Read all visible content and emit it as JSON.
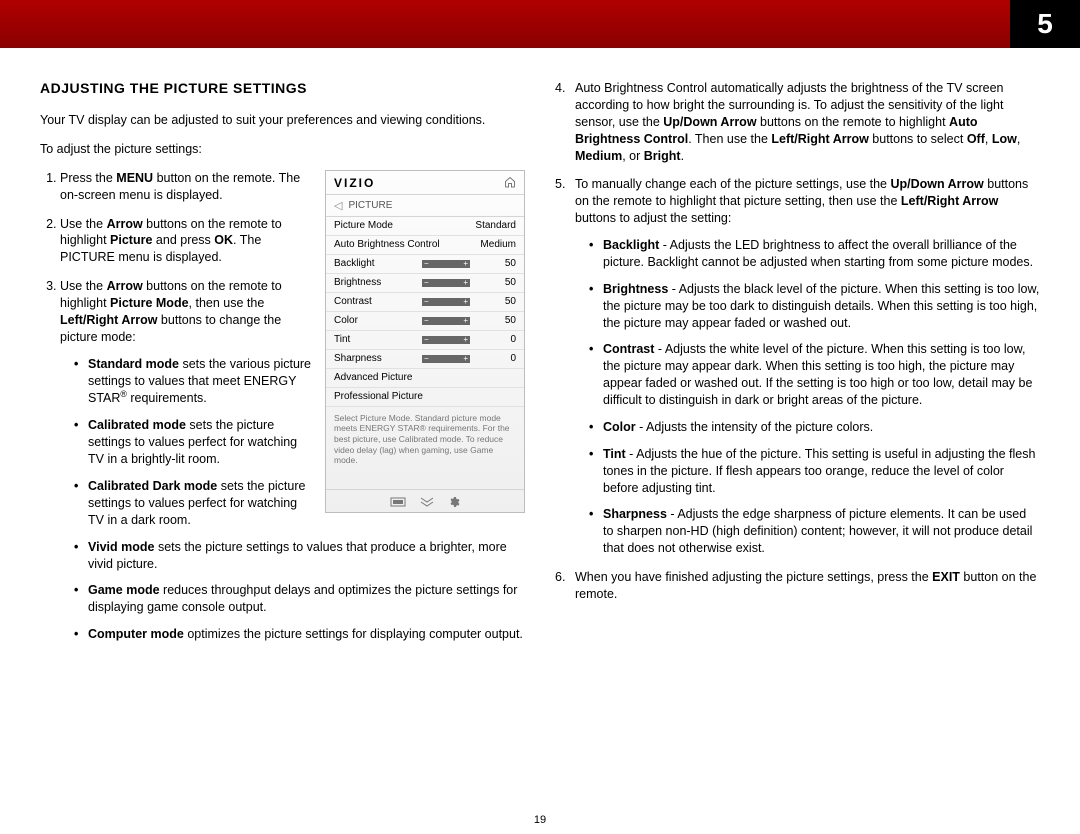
{
  "chapter_number": "5",
  "page_number": "19",
  "section_title": "ADJUSTING THE PICTURE SETTINGS",
  "intro1": "Your TV display can be adjusted to suit your preferences and viewing conditions.",
  "intro2": "To adjust the picture settings:",
  "step1_a": "Press the ",
  "step1_menu": "MENU",
  "step1_b": " button on the remote. The on-screen menu is displayed.",
  "step2_a": "Use the ",
  "step2_arrow": "Arrow",
  "step2_b": " buttons on the remote to highlight ",
  "step2_picture": "Picture",
  "step2_c": " and press ",
  "step2_ok": "OK",
  "step2_d": ". The PICTURE menu is displayed.",
  "step3_a": "Use the ",
  "step3_arrow": "Arrow",
  "step3_b": " buttons on the remote to highlight ",
  "step3_pm": "Picture Mode",
  "step3_c": ", then use the ",
  "step3_lr": "Left/Right Arrow",
  "step3_d": " buttons to change the picture mode:",
  "modes": {
    "standard_t": "Standard mode",
    "standard_d": " sets the various picture settings to values that meet ENERGY STAR",
    "standard_suffix": " requirements.",
    "calibrated_t": "Calibrated mode",
    "calibrated_d": " sets the picture settings to values perfect for watching TV in a brightly-lit room.",
    "calibrated_dark_t": "Calibrated Dark mode",
    "calibrated_dark_d": " sets the picture settings to values perfect for watching TV in a dark room.",
    "vivid_t": "Vivid mode",
    "vivid_d": " sets the picture settings to values that produce a brighter, more vivid picture.",
    "game_t": "Game mode",
    "game_d": " reduces throughput delays and optimizes the picture settings for displaying game console output.",
    "computer_t": "Computer mode",
    "computer_d": " optimizes the picture settings for displaying computer output."
  },
  "step4_a": "Auto Brightness Control automatically adjusts the brightness of the TV screen according to how bright the surrounding is. To adjust the sensitivity of the light sensor, use the ",
  "step4_ud": "Up/Down Arrow",
  "step4_b": " buttons on the remote to highlight ",
  "step4_abc": "Auto Brightness Control",
  "step4_c": ". Then use the ",
  "step4_lr": "Left/Right Arrow",
  "step4_d": " buttons to select ",
  "step4_off": "Off",
  "step4_sep1": ", ",
  "step4_low": "Low",
  "step4_sep2": ", ",
  "step4_med": "Medium",
  "step4_sep3": ", or ",
  "step4_bright": "Bright",
  "step4_e": ".",
  "step5_a": "To manually change each of the picture settings, use the ",
  "step5_ud": "Up/Down Arrow",
  "step5_b": " buttons on the remote to highlight that picture setting, then use the ",
  "step5_lr": "Left/Right Arrow",
  "step5_c": " buttons to adjust the setting:",
  "settings": {
    "backlight_t": "Backlight",
    "backlight_d": " - Adjusts the LED brightness to affect the overall brilliance of the picture. Backlight cannot be adjusted when starting from some picture modes.",
    "brightness_t": "Brightness",
    "brightness_d": " - Adjusts the black level of the picture. When this setting is too low, the picture may be too dark to distinguish details. When this setting is too high, the picture may appear faded or washed out.",
    "contrast_t": "Contrast",
    "contrast_d": " - Adjusts the white level of the picture. When this setting is too low, the picture may appear dark. When this setting is too high, the picture may appear faded or washed out. If the setting is too high or too low, detail may be difficult to distinguish in dark or bright areas of the picture.",
    "color_t": "Color",
    "color_d": " - Adjusts the intensity of the picture colors.",
    "tint_t": "Tint",
    "tint_d": " - Adjusts the hue of the picture. This setting is useful in adjusting the flesh tones in the picture. If flesh appears too orange, reduce the level of color before adjusting tint.",
    "sharpness_t": "Sharpness",
    "sharpness_d": " - Adjusts the edge sharpness of picture elements. It can be used to sharpen non-HD (high definition) content; however, it will not produce detail that does not otherwise exist."
  },
  "step6_a": "When you have finished adjusting the picture settings, press the ",
  "step6_exit": "EXIT",
  "step6_b": " button on the remote.",
  "osd": {
    "logo": "VIZIO",
    "crumb": "PICTURE",
    "rows": [
      {
        "label": "Picture Mode",
        "value": "Standard",
        "slider": false
      },
      {
        "label": "Auto Brightness Control",
        "value": "Medium",
        "slider": false
      },
      {
        "label": "Backlight",
        "value": "50",
        "slider": true
      },
      {
        "label": "Brightness",
        "value": "50",
        "slider": true
      },
      {
        "label": "Contrast",
        "value": "50",
        "slider": true
      },
      {
        "label": "Color",
        "value": "50",
        "slider": true
      },
      {
        "label": "Tint",
        "value": "0",
        "slider": true
      },
      {
        "label": "Sharpness",
        "value": "0",
        "slider": true
      },
      {
        "label": "Advanced Picture",
        "value": "",
        "slider": false
      },
      {
        "label": "Professional Picture",
        "value": "",
        "slider": false
      }
    ],
    "help": "Select Picture Mode. Standard picture mode meets ENERGY STAR® requirements. For the best picture, use Calibrated mode. To reduce video delay (lag) when gaming, use Game mode."
  }
}
